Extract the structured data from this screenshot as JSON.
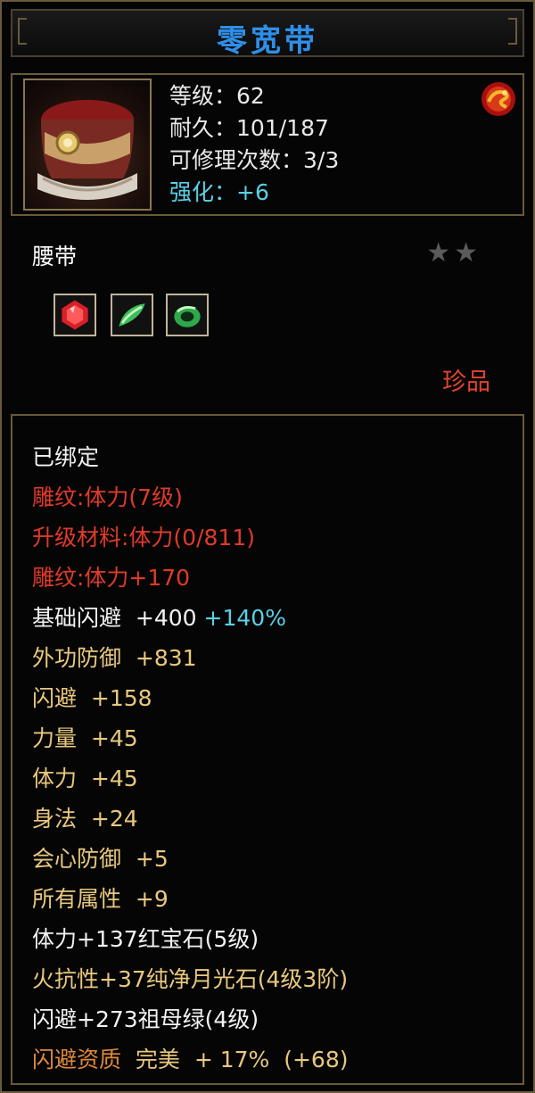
{
  "header": {
    "title": "零宽带"
  },
  "item": {
    "level_label": "等级",
    "level_value": "62",
    "durability_label": "耐久",
    "durability_value": "101/187",
    "repairs_label": "可修理次数",
    "repairs_value": "3/3",
    "enhance_label": "强化",
    "enhance_value": "+6",
    "icon": "belt-icon",
    "seal_icon": "dragon-seal-icon"
  },
  "type_label": "腰带",
  "stars": {
    "filled": 2,
    "glyph": "★★"
  },
  "gems": [
    {
      "icon": "ruby-gem-icon",
      "color": "#d8202a"
    },
    {
      "icon": "jade-feather-icon",
      "color": "#3cbf5a"
    },
    {
      "icon": "emerald-ring-icon",
      "color": "#2ea84a"
    }
  ],
  "rarity": "珍品",
  "stats": {
    "bound": "已绑定",
    "engrave": "雕纹:体力(7级)",
    "upgrade_material": "升级材料:体力(0/811)",
    "engrave_bonus": "雕纹:体力+170",
    "base_dodge_label": "基础闪避",
    "base_dodge_value": "+400",
    "base_dodge_pct": "+140%",
    "outer_defense_label": "外功防御",
    "outer_defense_value": "+831",
    "dodge_label": "闪避",
    "dodge_value": "+158",
    "strength_label": "力量",
    "strength_value": "+45",
    "stamina_label": "体力",
    "stamina_value": "+45",
    "agility_label": "身法",
    "agility_value": "+24",
    "crit_defense_label": "会心防御",
    "crit_defense_value": "+5",
    "all_attr_label": "所有属性",
    "all_attr_value": "+9",
    "gem1": "体力+137红宝石(5级)",
    "gem2": "火抗性+37纯净月光石(4级3阶)",
    "gem3": "闪避+273祖母绿(4级)",
    "quality_label": "闪避资质",
    "quality_grade": "完美",
    "quality_pct": "+ 17%",
    "quality_bonus": "(+68)"
  },
  "colors": {
    "title_blue": "#2f8fe8",
    "cyan": "#5ad0e6",
    "red": "#e03a2a",
    "gold": "#e8c87e",
    "orange": "#e08a3a",
    "rarity_red": "#e2442e"
  }
}
